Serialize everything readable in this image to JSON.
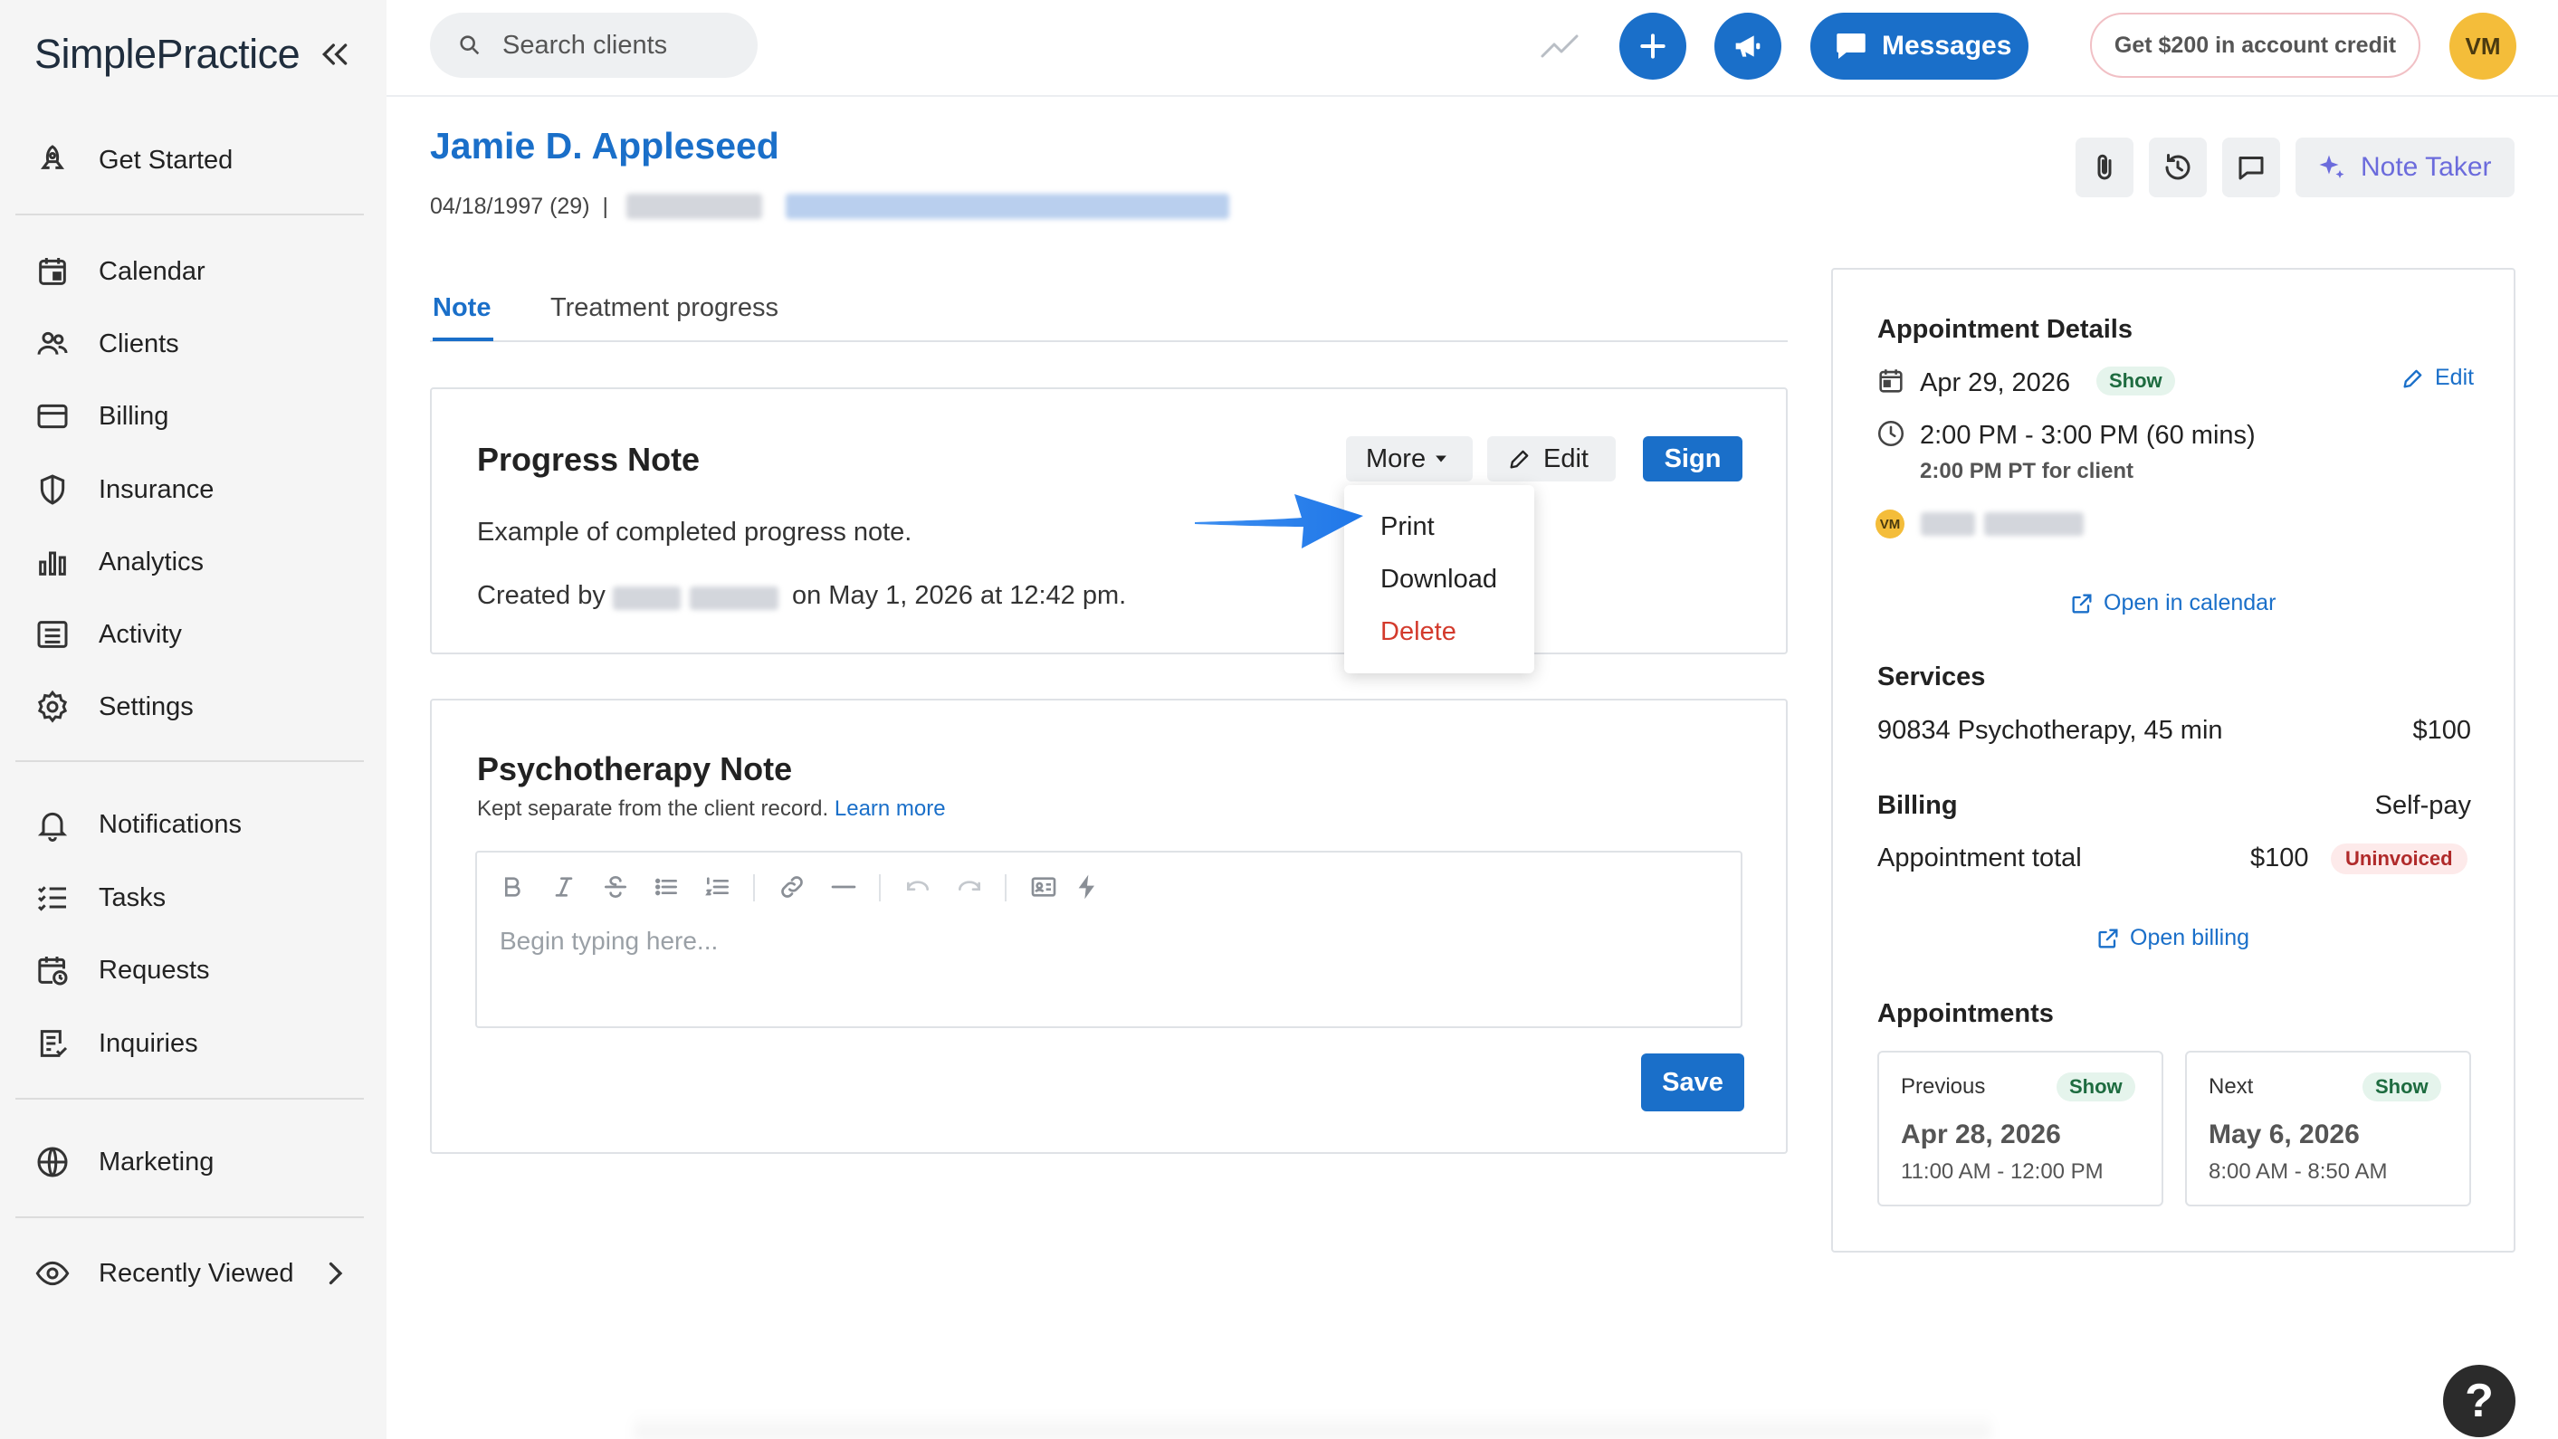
{
  "app": {
    "logo_text": "SimplePractice",
    "brand_color": "#1a6fc9"
  },
  "sidebar": {
    "items": [
      {
        "label": "Get Started",
        "icon": "rocket-icon"
      },
      {
        "label": "Calendar",
        "icon": "calendar-icon"
      },
      {
        "label": "Clients",
        "icon": "users-icon"
      },
      {
        "label": "Billing",
        "icon": "credit-card-icon"
      },
      {
        "label": "Insurance",
        "icon": "shield-icon"
      },
      {
        "label": "Analytics",
        "icon": "bar-chart-icon"
      },
      {
        "label": "Activity",
        "icon": "list-icon"
      },
      {
        "label": "Settings",
        "icon": "gear-icon"
      },
      {
        "label": "Notifications",
        "icon": "bell-icon"
      },
      {
        "label": "Tasks",
        "icon": "checklist-icon"
      },
      {
        "label": "Requests",
        "icon": "calendar-clock-icon"
      },
      {
        "label": "Inquiries",
        "icon": "document-list-icon"
      },
      {
        "label": "Marketing",
        "icon": "globe-icon"
      },
      {
        "label": "Recently Viewed",
        "icon": "eye-icon"
      }
    ]
  },
  "topbar": {
    "search_placeholder": "Search clients",
    "messages_label": "Messages",
    "credit_label": "Get $200 in account credit",
    "avatar_initials": "VM"
  },
  "client": {
    "name": "Jamie D. Appleseed",
    "dob": "04/18/1997 (29)",
    "separator": "|"
  },
  "header_actions": {
    "note_taker_label": "Note Taker"
  },
  "tabs": [
    {
      "label": "Note",
      "active": true
    },
    {
      "label": "Treatment progress",
      "active": false
    }
  ],
  "progress_note": {
    "title": "Progress Note",
    "more_label": "More",
    "edit_label": "Edit",
    "sign_label": "Sign",
    "body": "Example of completed progress note.",
    "created_prefix": "Created by",
    "created_suffix": "on May 1, 2026 at 12:42 pm.",
    "menu": {
      "print": "Print",
      "download": "Download",
      "delete": "Delete"
    }
  },
  "psychotherapy_note": {
    "title": "Psychotherapy Note",
    "subtitle": "Kept separate from the client record.",
    "learn_more": "Learn more",
    "placeholder": "Begin typing here...",
    "save_label": "Save"
  },
  "appointment": {
    "heading": "Appointment Details",
    "date": "Apr 29, 2026",
    "status": "Show",
    "edit_label": "Edit",
    "time": "2:00 PM - 3:00 PM (60 mins)",
    "client_time": "2:00 PM PT for client",
    "clinician_initials": "VM",
    "open_calendar": "Open in calendar"
  },
  "services": {
    "heading": "Services",
    "name": "90834 Psychotherapy, 45 min",
    "price": "$100"
  },
  "billing": {
    "heading": "Billing",
    "type": "Self-pay",
    "total_label": "Appointment total",
    "total": "$100",
    "status": "Uninvoiced",
    "open_billing": "Open billing"
  },
  "appointments": {
    "heading": "Appointments",
    "previous": {
      "label": "Previous",
      "status": "Show",
      "date": "Apr 28, 2026",
      "time": "11:00 AM - 12:00 PM"
    },
    "next": {
      "label": "Next",
      "status": "Show",
      "date": "May 6, 2026",
      "time": "8:00 AM - 8:50 AM"
    }
  },
  "help_label": "?"
}
